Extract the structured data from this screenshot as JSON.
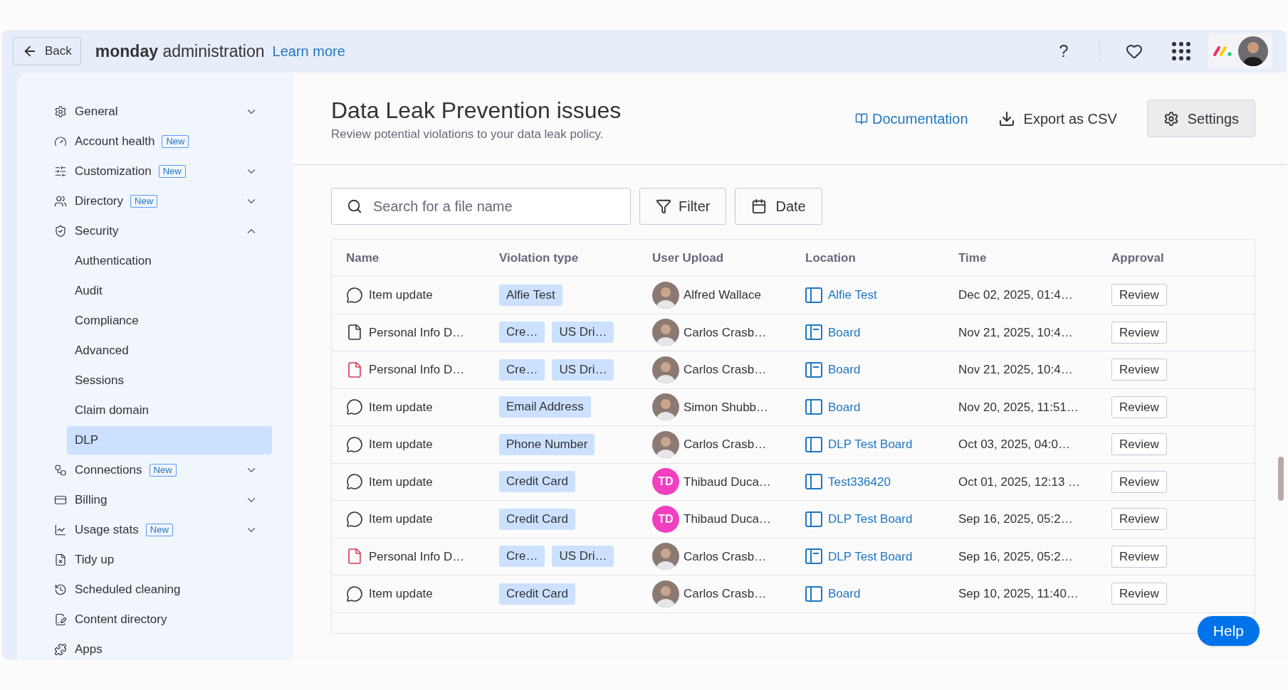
{
  "topbar": {
    "back": "Back",
    "brand_bold": "monday",
    "brand_rest": "administration",
    "learn_more": "Learn more",
    "help_glyph": "?"
  },
  "sidebar": {
    "items": [
      {
        "label": "General",
        "selected": false,
        "expanded": false
      },
      {
        "label": "Account health",
        "badge": "New",
        "selected": false
      },
      {
        "label": "Customization",
        "badge": "New",
        "selected": false,
        "expanded": false
      },
      {
        "label": "Directory",
        "badge": "New",
        "selected": false,
        "expanded": false
      },
      {
        "label": "Security",
        "selected": false,
        "expanded": true,
        "children": [
          {
            "label": "Authentication",
            "selected": false
          },
          {
            "label": "Audit",
            "selected": false
          },
          {
            "label": "Compliance",
            "selected": false
          },
          {
            "label": "Advanced",
            "selected": false
          },
          {
            "label": "Sessions",
            "selected": false
          },
          {
            "label": "Claim domain",
            "selected": false
          },
          {
            "label": "DLP",
            "selected": true
          }
        ]
      },
      {
        "label": "Connections",
        "badge": "New",
        "selected": false,
        "expanded": false
      },
      {
        "label": "Billing",
        "selected": false,
        "expanded": false
      },
      {
        "label": "Usage stats",
        "badge": "New",
        "selected": false,
        "expanded": false
      },
      {
        "label": "Tidy up",
        "selected": false
      },
      {
        "label": "Scheduled cleaning",
        "selected": false
      },
      {
        "label": "Content directory",
        "selected": false
      },
      {
        "label": "Apps",
        "selected": false
      }
    ]
  },
  "page": {
    "title": "Data Leak Prevention issues",
    "subtitle": "Review potential violations to your data leak policy.",
    "actions": {
      "documentation": "Documentation",
      "export": "Export as CSV",
      "settings": "Settings"
    }
  },
  "toolbar": {
    "search": {
      "placeholder": "Search for a file name"
    },
    "filter": "Filter",
    "date": "Date"
  },
  "table": {
    "columns": [
      "Name",
      "Violation type",
      "User Upload",
      "Location",
      "Time",
      "Approval"
    ],
    "rows": [
      {
        "kind": "comment",
        "name": "Item update",
        "tags": [
          "Alfie Test"
        ],
        "user": {
          "kind": "picture",
          "name": "Alfred Wallace"
        },
        "location": {
          "kind": "board",
          "text": "Alfie Test"
        },
        "time": "Dec 02, 2025, 01:4…",
        "approval": "Review"
      },
      {
        "kind": "document",
        "name": "Personal Info D…",
        "tags": [
          "Cre…",
          "US Dri…"
        ],
        "user": {
          "kind": "picture",
          "name": "Carlos Crasb…"
        },
        "location": {
          "kind": "doc",
          "text": "Board"
        },
        "time": "Nov 21, 2025, 10:4…",
        "approval": "Review"
      },
      {
        "kind": "pdf",
        "name": "Personal Info D…",
        "tags": [
          "Cre…",
          "US Dri…"
        ],
        "user": {
          "kind": "picture",
          "name": "Carlos Crasb…"
        },
        "location": {
          "kind": "doc",
          "text": "Board"
        },
        "time": "Nov 21, 2025, 10:4…",
        "approval": "Review"
      },
      {
        "kind": "comment",
        "name": "Item update",
        "tags": [
          "Email Address"
        ],
        "user": {
          "kind": "picture",
          "name": "Simon Shubb…"
        },
        "location": {
          "kind": "board",
          "text": "Board"
        },
        "time": "Nov 20, 2025, 11:51…",
        "approval": "Review"
      },
      {
        "kind": "comment",
        "name": "Item update",
        "tags": [
          "Phone Number"
        ],
        "user": {
          "kind": "picture",
          "name": "Carlos Crasb…"
        },
        "location": {
          "kind": "board",
          "text": "DLP Test Board"
        },
        "time": "Oct 03, 2025, 04:0…",
        "approval": "Review"
      },
      {
        "kind": "comment",
        "name": "Item update",
        "tags": [
          "Credit Card"
        ],
        "user": {
          "kind": "initials",
          "initials": "TD",
          "color": "#f23fbf",
          "name": "Thibaud Duca…"
        },
        "location": {
          "kind": "board",
          "text": "Test336420"
        },
        "time": "Oct 01, 2025, 12:13 …",
        "approval": "Review"
      },
      {
        "kind": "comment",
        "name": "Item update",
        "tags": [
          "Credit Card"
        ],
        "user": {
          "kind": "initials",
          "initials": "TD",
          "color": "#f23fbf",
          "name": "Thibaud Duca…"
        },
        "location": {
          "kind": "board",
          "text": "DLP Test Board"
        },
        "time": "Sep 16, 2025, 05:2…",
        "approval": "Review"
      },
      {
        "kind": "pdf",
        "name": "Personal Info D…",
        "tags": [
          "Cre…",
          "US Dri…"
        ],
        "user": {
          "kind": "picture",
          "name": "Carlos Crasb…"
        },
        "location": {
          "kind": "doc",
          "text": "DLP Test Board"
        },
        "time": "Sep 16, 2025, 05:2…",
        "approval": "Review"
      },
      {
        "kind": "comment",
        "name": "Item update",
        "tags": [
          "Credit Card"
        ],
        "user": {
          "kind": "picture",
          "name": "Carlos Crasb…"
        },
        "location": {
          "kind": "board",
          "text": "Board"
        },
        "time": "Sep 10, 2025, 11:40…",
        "approval": "Review"
      }
    ]
  },
  "help": "Help"
}
